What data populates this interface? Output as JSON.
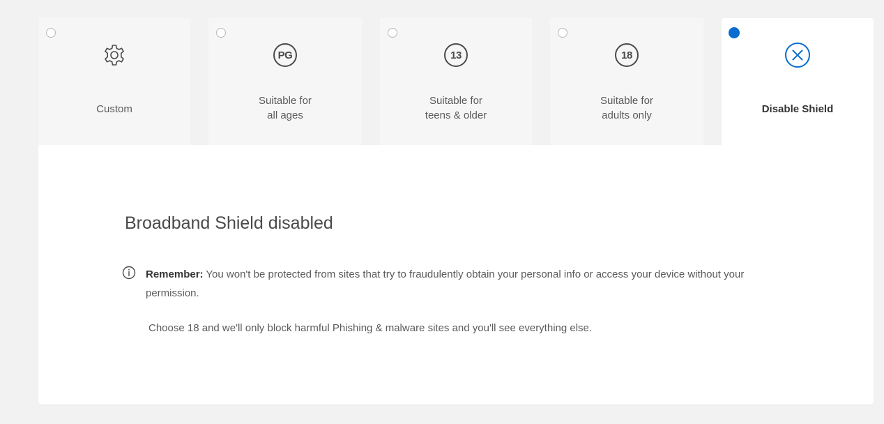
{
  "tabs": [
    {
      "id": "custom",
      "label": "Custom",
      "icon": "gear-icon",
      "selected": false
    },
    {
      "id": "pg",
      "label": "Suitable for\nall ages",
      "badge": "PG",
      "icon": "pg-rating-icon",
      "selected": false
    },
    {
      "id": "13",
      "label": "Suitable for\nteens & older",
      "badge": "13",
      "icon": "13-rating-icon",
      "selected": false
    },
    {
      "id": "18",
      "label": "Suitable for\nadults only",
      "badge": "18",
      "icon": "18-rating-icon",
      "selected": false
    },
    {
      "id": "disable",
      "label": "Disable Shield",
      "icon": "close-circle-icon",
      "selected": true
    }
  ],
  "content": {
    "title": "Broadband Shield disabled",
    "remember_label": "Remember:",
    "remember_text": " You won't be protected from sites that try to fraudulently obtain your personal info or access your device without your permission.",
    "tip": "Choose 18 and we'll only block harmful Phishing & malware sites and you'll see everything else."
  },
  "colors": {
    "accent": "#0a6ccf",
    "background": "#f2f2f2",
    "card": "#ffffff"
  }
}
